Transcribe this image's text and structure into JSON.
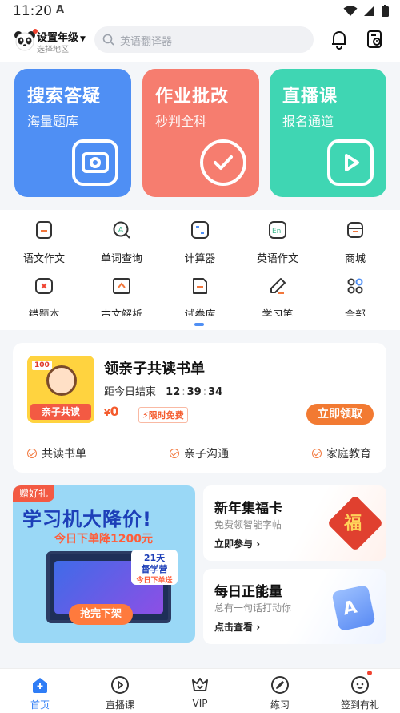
{
  "status": {
    "time": "11:20",
    "notification": "A"
  },
  "header": {
    "grade": "设置年级",
    "region": "选择地区",
    "search_placeholder": "英语翻译器"
  },
  "main_cards": [
    {
      "title": "搜索答疑",
      "subtitle": "海量题库",
      "color": "#4f8ff4"
    },
    {
      "title": "作业批改",
      "subtitle": "秒判全科",
      "color": "#f67d6f"
    },
    {
      "title": "直播课",
      "subtitle": "报名通道",
      "color": "#3fd6b3"
    }
  ],
  "tools": [
    {
      "label": "语文作文",
      "icon": "essay-icon"
    },
    {
      "label": "单词查询",
      "icon": "word-search-icon"
    },
    {
      "label": "计算器",
      "icon": "calculator-icon"
    },
    {
      "label": "英语作文",
      "icon": "english-essay-icon"
    },
    {
      "label": "商城",
      "icon": "shop-icon"
    },
    {
      "label": "错题本",
      "icon": "wrong-book-icon"
    },
    {
      "label": "古文解析",
      "icon": "classical-text-icon"
    },
    {
      "label": "试卷库",
      "icon": "exam-library-icon"
    },
    {
      "label": "学习笔",
      "icon": "study-pen-icon"
    },
    {
      "label": "全部",
      "icon": "all-apps-icon"
    }
  ],
  "promo": {
    "thumb_tag": "100",
    "thumb_ribbon": "亲子共读",
    "title": "领亲子共读书单",
    "countdown_label": "距今日结束",
    "countdown": [
      "12",
      "39",
      "34"
    ],
    "price_symbol": "¥",
    "price": "0",
    "free_tag": "限时免费",
    "claim_button": "立即领取",
    "features": [
      "共读书单",
      "亲子沟通",
      "家庭教育"
    ]
  },
  "banner": {
    "gift": "赠好礼",
    "headline": "学习机大降价!",
    "sub": "今日下单降1200元",
    "badge_line1": "21天",
    "badge_line2": "督学营",
    "badge_line3": "今日下单送",
    "button": "抢完下架"
  },
  "side_cards": [
    {
      "title": "新年集福卡",
      "desc": "免费领智能字帖",
      "action": "立即参与",
      "art": "福"
    },
    {
      "title": "每日正能量",
      "desc": "总有一句话打动你",
      "action": "点击查看",
      "art": "A"
    }
  ],
  "tabs": [
    {
      "label": "首页",
      "icon": "home-icon",
      "active": true
    },
    {
      "label": "直播课",
      "icon": "play-icon",
      "active": false
    },
    {
      "label": "VIP",
      "icon": "vip-crown-icon",
      "active": false
    },
    {
      "label": "练习",
      "icon": "pen-icon",
      "active": false
    },
    {
      "label": "签到有礼",
      "icon": "checkin-icon",
      "active": false
    }
  ]
}
